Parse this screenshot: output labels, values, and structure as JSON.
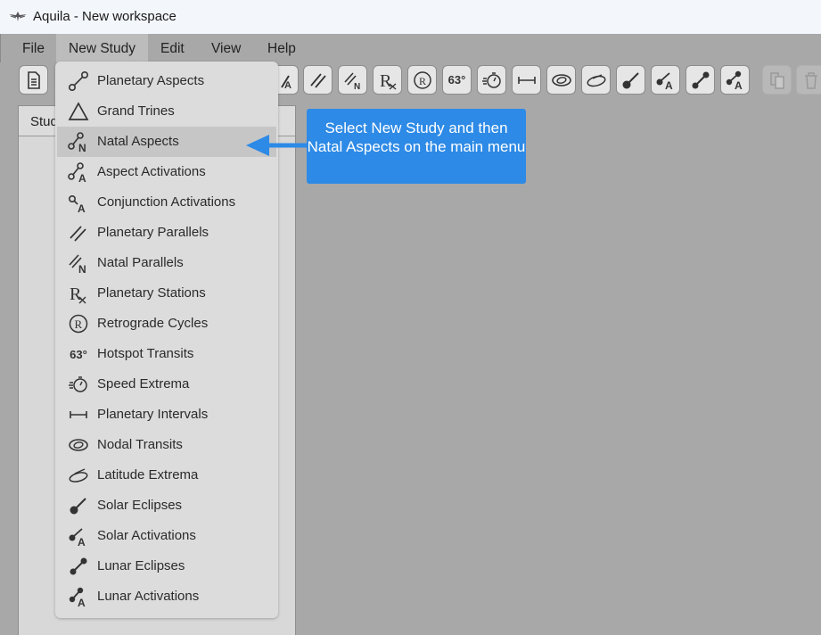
{
  "window": {
    "title": "Aquila - New workspace"
  },
  "menubar": {
    "items": [
      {
        "label": "File"
      },
      {
        "label": "New Study"
      },
      {
        "label": "Edit"
      },
      {
        "label": "View"
      },
      {
        "label": "Help"
      }
    ]
  },
  "panel": {
    "tab_label": "Stud"
  },
  "toolbar": {
    "degree_label": "63°",
    "icons": [
      "new-document",
      "conjunction-activations",
      "planetary-parallels",
      "natal-parallels",
      "planetary-stations",
      "retrograde-cycles",
      "hotspot-transits",
      "speed-extrema",
      "planetary-intervals",
      "nodal-transits",
      "latitude-extrema",
      "solar-eclipses",
      "solar-activations",
      "lunar-eclipses",
      "lunar-activations",
      "copy",
      "delete"
    ]
  },
  "new_study_menu": {
    "items": [
      {
        "label": "Planetary Aspects",
        "icon": "planetary-aspects"
      },
      {
        "label": "Grand Trines",
        "icon": "grand-trines"
      },
      {
        "label": "Natal Aspects",
        "icon": "natal-aspects",
        "highlighted": true
      },
      {
        "label": "Aspect Activations",
        "icon": "aspect-activations"
      },
      {
        "label": "Conjunction Activations",
        "icon": "conjunction-activations"
      },
      {
        "label": "Planetary Parallels",
        "icon": "planetary-parallels"
      },
      {
        "label": "Natal Parallels",
        "icon": "natal-parallels"
      },
      {
        "label": "Planetary Stations",
        "icon": "planetary-stations"
      },
      {
        "label": "Retrograde Cycles",
        "icon": "retrograde-cycles"
      },
      {
        "label": "Hotspot Transits",
        "icon": "hotspot-transits",
        "icon_text": "63°"
      },
      {
        "label": "Speed Extrema",
        "icon": "speed-extrema"
      },
      {
        "label": "Planetary Intervals",
        "icon": "planetary-intervals"
      },
      {
        "label": "Nodal Transits",
        "icon": "nodal-transits"
      },
      {
        "label": "Latitude Extrema",
        "icon": "latitude-extrema"
      },
      {
        "label": "Solar Eclipses",
        "icon": "solar-eclipses"
      },
      {
        "label": "Solar Activations",
        "icon": "solar-activations"
      },
      {
        "label": "Lunar Eclipses",
        "icon": "lunar-eclipses"
      },
      {
        "label": "Lunar Activations",
        "icon": "lunar-activations"
      }
    ]
  },
  "callout": {
    "text": "Select New Study and then Natal Aspects on the main menu"
  },
  "colors": {
    "callout": "#2d8ae6",
    "workspace": "#a8a8a8",
    "menu": "#dcdcdc",
    "highlight": "#c6c6c6"
  }
}
